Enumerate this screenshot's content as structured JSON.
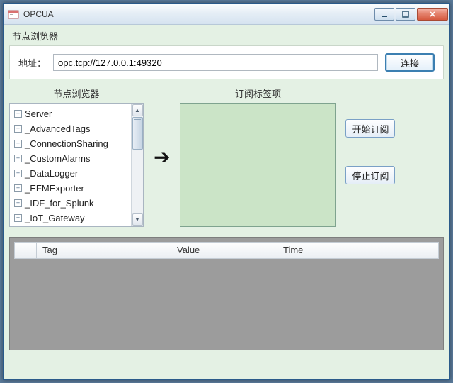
{
  "window": {
    "title": "OPCUA"
  },
  "panel": {
    "title": "节点浏览器"
  },
  "address": {
    "label": "地址：",
    "value": "opc.tcp://127.0.0.1:49320",
    "connect_label": "连接"
  },
  "browser": {
    "title": "节点浏览器",
    "items": [
      {
        "label": "Server"
      },
      {
        "label": "_AdvancedTags"
      },
      {
        "label": "_ConnectionSharing"
      },
      {
        "label": "_CustomAlarms"
      },
      {
        "label": "_DataLogger"
      },
      {
        "label": "_EFMExporter"
      },
      {
        "label": "_IDF_for_Splunk"
      },
      {
        "label": "_IoT_Gateway"
      }
    ]
  },
  "subs": {
    "title": "订阅标签项",
    "start_label": "开始订阅",
    "stop_label": "停止订阅"
  },
  "grid": {
    "columns": {
      "rowhead": "",
      "tag": "Tag",
      "value": "Value",
      "time": "Time"
    }
  }
}
